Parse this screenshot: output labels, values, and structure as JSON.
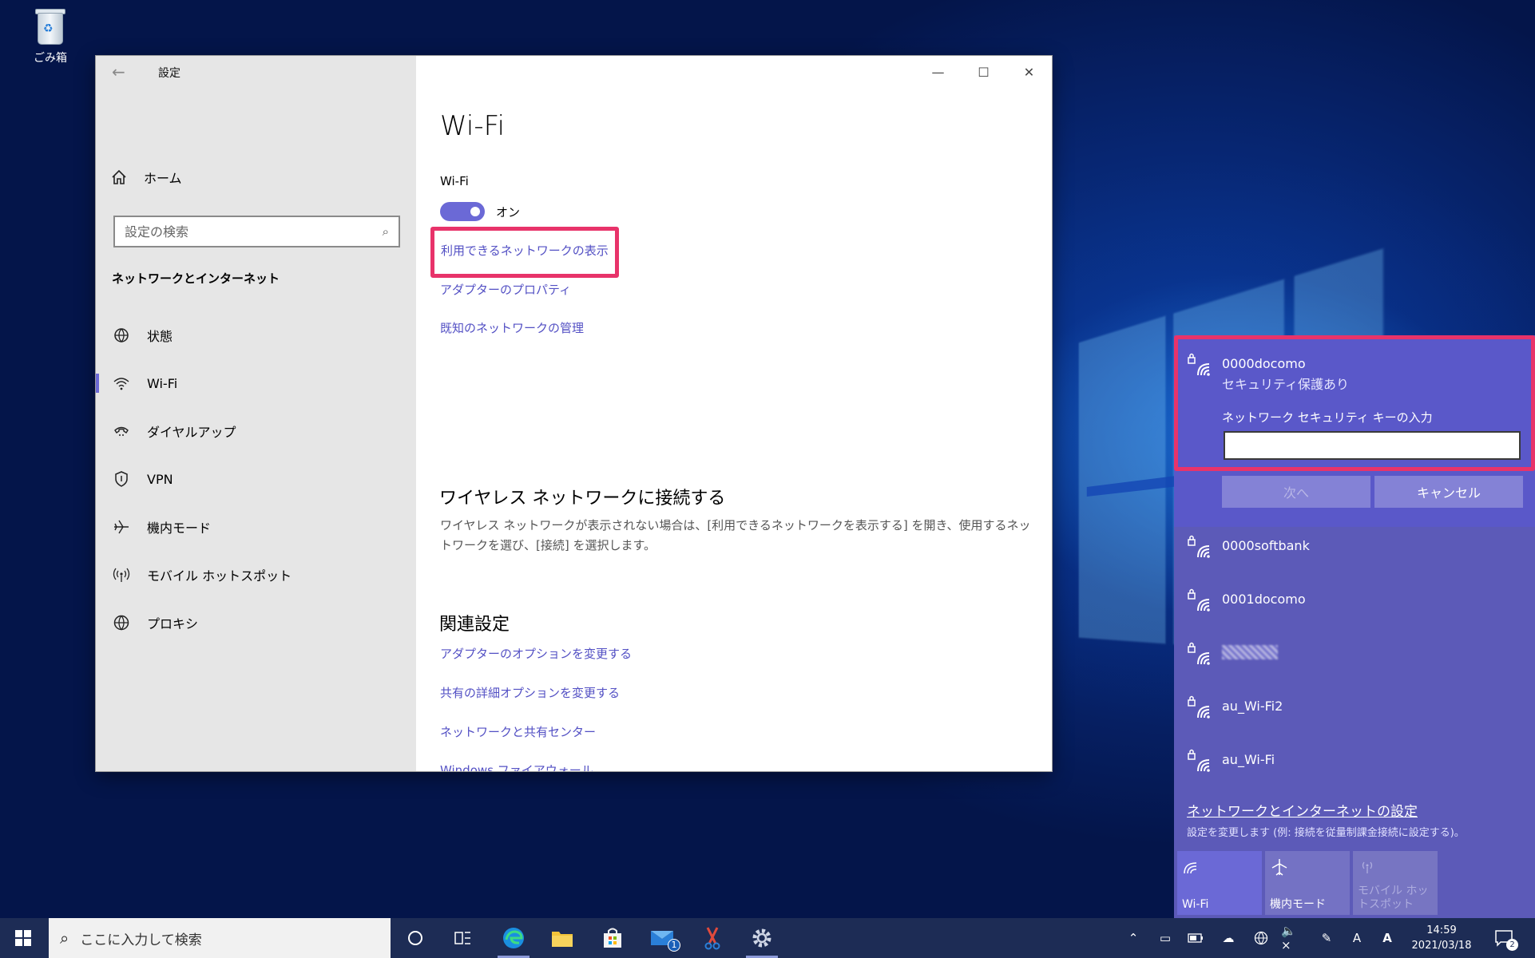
{
  "desktop": {
    "recycle_bin_label": "ごみ箱"
  },
  "settings_window": {
    "title": "設定",
    "sidebar": {
      "home_label": "ホーム",
      "search_placeholder": "設定の検索",
      "section_title": "ネットワークとインターネット",
      "items": [
        {
          "label": "状態",
          "icon": "globe-status-icon"
        },
        {
          "label": "Wi-Fi",
          "icon": "wifi-icon",
          "active": true
        },
        {
          "label": "ダイヤルアップ",
          "icon": "dialup-icon"
        },
        {
          "label": "VPN",
          "icon": "vpn-shield-icon"
        },
        {
          "label": "機内モード",
          "icon": "airplane-icon"
        },
        {
          "label": "モバイル ホットスポット",
          "icon": "hotspot-icon"
        },
        {
          "label": "プロキシ",
          "icon": "globe-icon"
        }
      ]
    },
    "content": {
      "page_title": "Wi-Fi",
      "wifi_label": "Wi-Fi",
      "toggle_state": "オン",
      "link_show_networks": "利用できるネットワークの表示",
      "link_adapter_properties": "アダプターのプロパティ",
      "link_manage_known": "既知のネットワークの管理",
      "connect_heading": "ワイヤレス ネットワークに接続する",
      "connect_text": "ワイヤレス ネットワークが表示されない場合は、[利用できるネットワークを表示する] を開き、使用するネットワークを選び、[接続] を選択します。",
      "related_heading": "関連設定",
      "related_links": [
        "アダプターのオプションを変更する",
        "共有の詳細オプションを変更する",
        "ネットワークと共有センター",
        "Windows ファイアウォール"
      ]
    }
  },
  "network_flyout": {
    "selected": {
      "name": "0000docomo",
      "status": "セキュリティ保護あり",
      "key_label": "ネットワーク セキュリティ キーの入力",
      "key_value": "",
      "next_button": "次へ",
      "cancel_button": "キャンセル"
    },
    "networks": [
      "0000softbank",
      "0001docomo",
      "",
      "au_Wi-Fi2",
      "au_Wi-Fi"
    ],
    "settings_link": "ネットワークとインターネットの設定",
    "settings_desc": "設定を変更します (例: 接続を従量制課金接続に設定する)。",
    "tiles": [
      {
        "label": "Wi-Fi",
        "state": "on"
      },
      {
        "label": "機内モード",
        "state": "off"
      },
      {
        "label": "モバイル ホットスポット",
        "state": "disabled"
      }
    ]
  },
  "taskbar": {
    "search_placeholder": "ここに入力して検索",
    "mail_badge": "1",
    "time": "14:59",
    "date": "2021/03/18",
    "notification_count": "2"
  },
  "colors": {
    "accent": "#6b69d6",
    "highlight_border": "#e8336a",
    "flyout_bg": "#5c5ab8"
  }
}
